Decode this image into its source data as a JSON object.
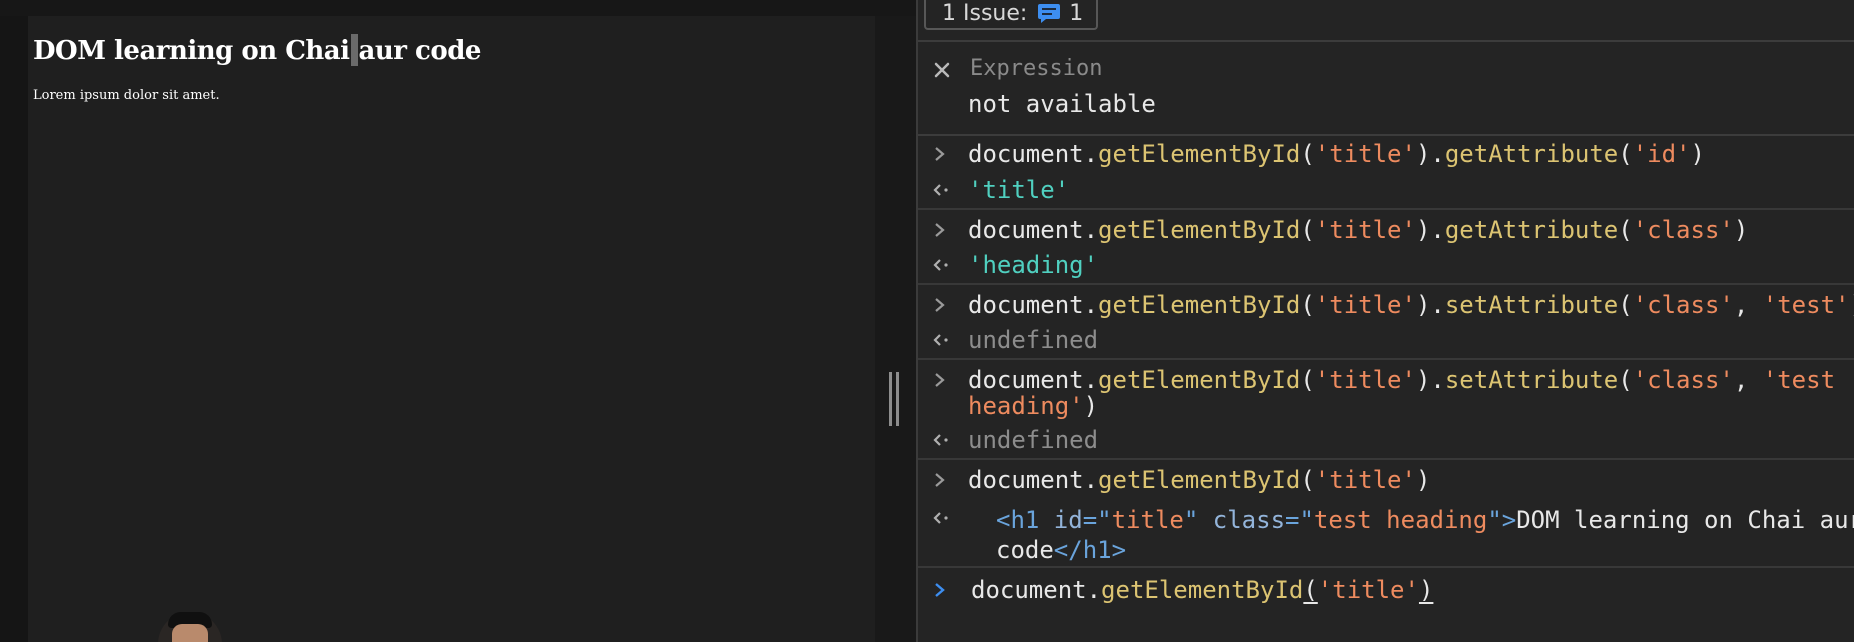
{
  "page": {
    "heading_before_caret": "DOM learning on Chai",
    "heading_after_caret": "aur code",
    "paragraph": "Lorem ipsum dolor sit amet."
  },
  "devtools": {
    "issues": {
      "label": "1 Issue:",
      "count": "1",
      "icon": "chat-bubble-icon"
    },
    "expression": {
      "placeholder": "Expression",
      "value": "not available"
    },
    "console": [
      {
        "input": [
          "document.",
          "getElementById",
          "(",
          "'title'",
          ").",
          "getAttribute",
          "(",
          "'id'",
          ")"
        ],
        "output": "'title'"
      },
      {
        "input": [
          "document.",
          "getElementById",
          "(",
          "'title'",
          ").",
          "getAttribute",
          "(",
          "'class'",
          ")"
        ],
        "output": "'heading'"
      },
      {
        "input": [
          "document.",
          "getElementById",
          "(",
          "'title'",
          ").",
          "setAttribute",
          "(",
          "'class'",
          ", ",
          "'test'",
          ")"
        ],
        "output": "undefined"
      },
      {
        "input_line1": [
          "document.",
          "getElementById",
          "(",
          "'title'",
          ").",
          "setAttribute",
          "(",
          "'class'",
          ", ",
          "'test"
        ],
        "input_line2": [
          "heading'",
          ")"
        ],
        "output": "undefined"
      },
      {
        "input": [
          "document.",
          "getElementById",
          "(",
          "'title'",
          ")"
        ],
        "output_line1": [
          "<h1 ",
          "id",
          "=\"",
          "title",
          "\" ",
          "class",
          "=\"",
          "test heading",
          "\">",
          "DOM learning on Chai aur"
        ],
        "output_line2": [
          "code",
          "</h1>"
        ]
      }
    ],
    "prompt": [
      "document.",
      "getElementById",
      "(",
      "'title'",
      ")"
    ]
  },
  "colors": {
    "string": "#ee8b5f",
    "function": "#dcc472",
    "result_string": "#50d0c0",
    "undefined": "#8d8d8d",
    "tag": "#6aa4dc",
    "prompt_chevron": "#3d8ef0"
  }
}
